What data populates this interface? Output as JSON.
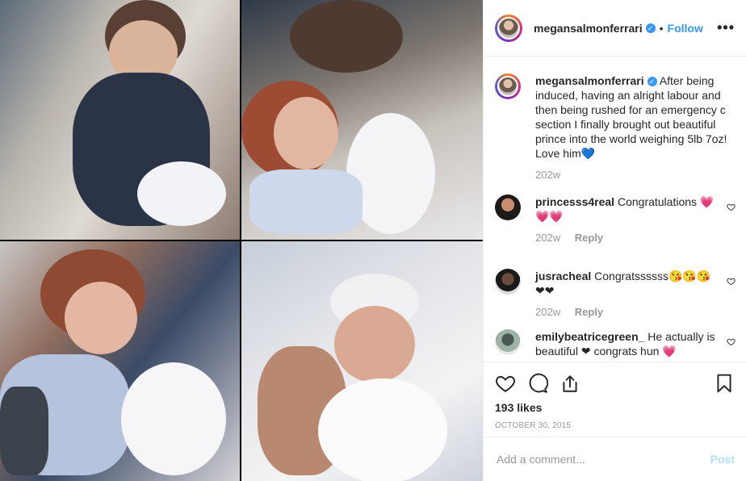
{
  "colors": {
    "accent": "#3897f0",
    "muted": "#999999",
    "post_disabled": "#b2dffc",
    "text": "#262626"
  },
  "header": {
    "username": "megansalmonferrari",
    "verified_icon": "verified-badge-icon",
    "separator": "•",
    "follow_label": "Follow",
    "more_label": "•••"
  },
  "caption": {
    "username": "megansalmonferrari",
    "text": "After being induced, having an alright labour and then being rushed for an emergency c section I finally brought out beautiful prince into the world weighing 5lb 7oz! Love him💙",
    "time": "202w"
  },
  "comments": [
    {
      "username": "princesss4real",
      "text": "Congratulations 💗💗💗",
      "time": "202w",
      "reply_label": "Reply"
    },
    {
      "username": "jusracheal",
      "text": "Congratssssss😘😘😘❤❤",
      "time": "202w",
      "reply_label": "Reply"
    },
    {
      "username": "emilybeatricegreen_",
      "text": "He actually is beautiful ❤ congrats hun 💗"
    }
  ],
  "actions": {
    "icons": [
      "heart-icon",
      "comment-icon",
      "share-icon",
      "bookmark-icon"
    ],
    "likes": "193 likes",
    "date": "OCTOBER 30, 2015"
  },
  "add_comment": {
    "placeholder": "Add a comment...",
    "post_label": "Post"
  }
}
